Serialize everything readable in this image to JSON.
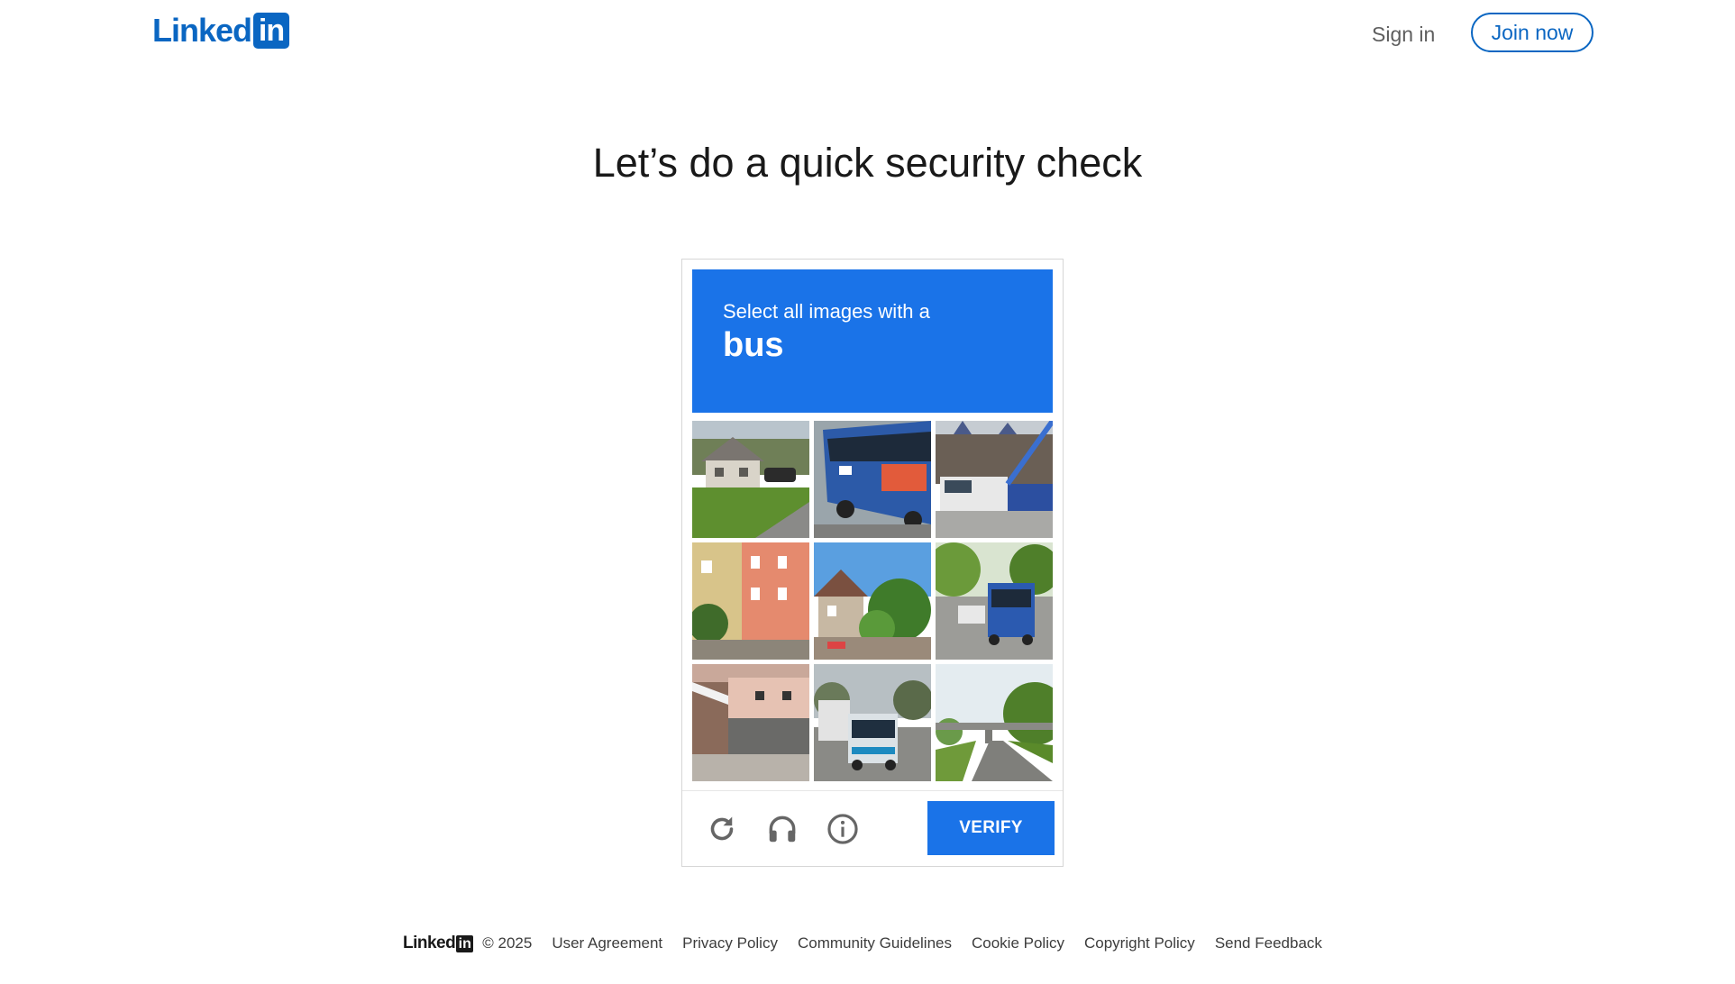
{
  "header": {
    "logo_text": "Linked",
    "logo_box_text": "in",
    "sign_in_label": "Sign in",
    "join_now_label": "Join now"
  },
  "page_title": "Let’s do a quick security check",
  "captcha": {
    "prompt_line1": "Select all images with a",
    "prompt_target": "bus",
    "tiles": [
      {
        "scene": "house-lawn"
      },
      {
        "scene": "bus-closeup"
      },
      {
        "scene": "bus-building"
      },
      {
        "scene": "street-houses"
      },
      {
        "scene": "house-trees"
      },
      {
        "scene": "bus-road-trees"
      },
      {
        "scene": "garage-building"
      },
      {
        "scene": "bus-trucks-road"
      },
      {
        "scene": "highway-bridge"
      }
    ],
    "icons": [
      "refresh-icon",
      "headphones-icon",
      "info-icon"
    ],
    "verify_label": "VERIFY",
    "colors": {
      "accent": "#1a73e8"
    }
  },
  "footer": {
    "logo_text": "Linked",
    "logo_box_text": "in",
    "copyright": "© 2025",
    "links": [
      "User Agreement",
      "Privacy Policy",
      "Community Guidelines",
      "Cookie Policy",
      "Copyright Policy",
      "Send Feedback"
    ]
  },
  "brand_color": "#0a66c2"
}
